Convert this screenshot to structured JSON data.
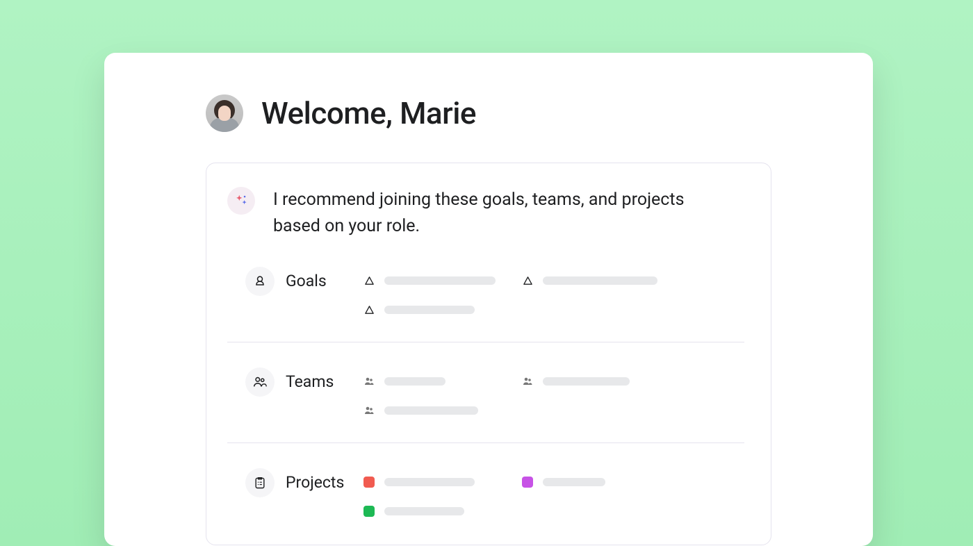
{
  "header": {
    "welcome_text": "Welcome, Marie"
  },
  "recommendation": {
    "message": "I recommend joining these goals, teams, and projects based on your role.",
    "sections": {
      "goals": {
        "label": "Goals"
      },
      "teams": {
        "label": "Teams"
      },
      "projects": {
        "label": "Projects"
      }
    }
  },
  "colors": {
    "project_red": "#f15b50",
    "project_purple": "#c752e6",
    "project_green": "#1db954"
  }
}
